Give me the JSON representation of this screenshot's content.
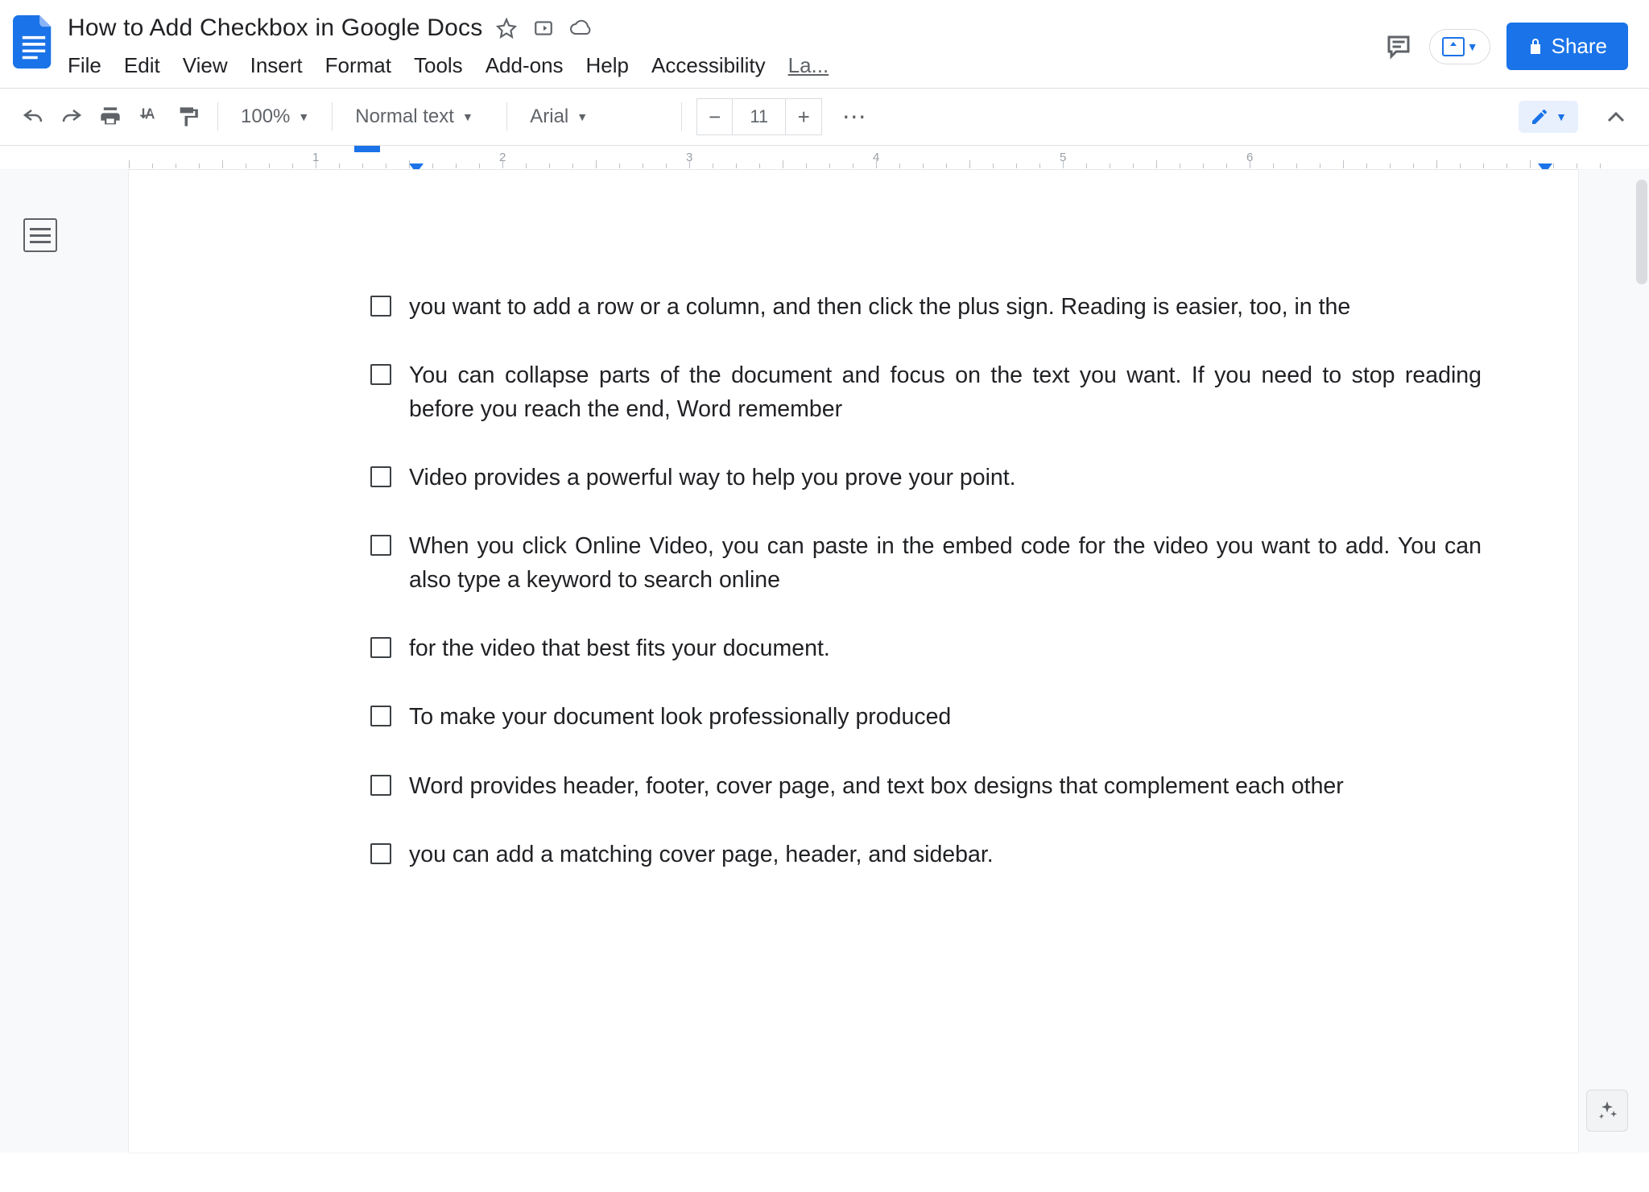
{
  "doc": {
    "title": "How to Add Checkbox in Google Docs"
  },
  "menu": {
    "items": [
      "File",
      "Edit",
      "View",
      "Insert",
      "Format",
      "Tools",
      "Add-ons",
      "Help",
      "Accessibility"
    ],
    "truncated": "La..."
  },
  "header_buttons": {
    "share": "Share"
  },
  "toolbar": {
    "zoom": "100%",
    "style": "Normal text",
    "font": "Arial",
    "font_size": "11"
  },
  "checklist": [
    "you want to add a row or a column, and then click the plus sign. Reading is easier, too, in the",
    "You can collapse parts of the document and focus on the text you want. If you need to stop reading before you reach the end, Word remember",
    " Video provides a powerful way to help you prove your point.",
    "When you click Online Video, you can paste in the embed code for the video you want to add. You can also type a keyword to search online",
    " for the video that best fits your document.",
    "To make your document look professionally produced",
    " Word provides header, footer, cover page, and text box designs that complement each other",
    " you can add a matching cover page, header, and sidebar."
  ],
  "ruler": {
    "numbers": [
      "1",
      "2",
      "3",
      "4",
      "5",
      "6"
    ]
  }
}
